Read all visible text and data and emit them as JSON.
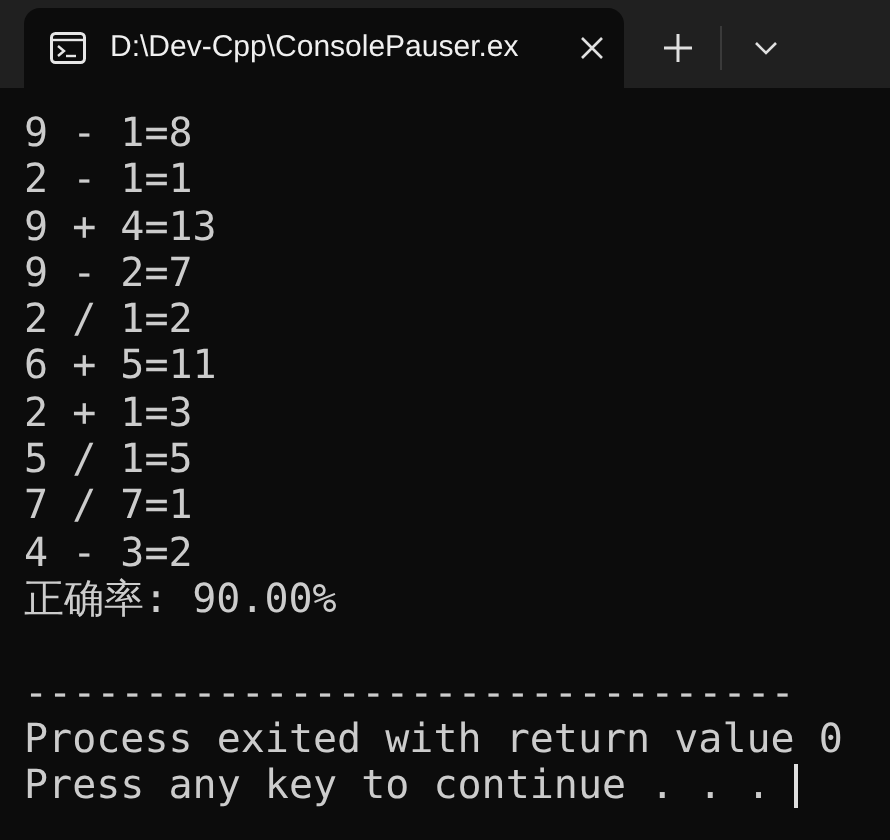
{
  "tab": {
    "title": "D:\\Dev-Cpp\\ConsolePauser.ex",
    "selected": true
  },
  "console": {
    "output": [
      "9 - 1=8",
      "2 - 1=1",
      "9 + 4=13",
      "9 - 2=7",
      "2 / 1=2",
      "6 + 5=11",
      "2 + 1=3",
      "5 / 1=5",
      "7 / 7=1",
      "4 - 3=2",
      "正确率: 90.00%"
    ],
    "separator": "--------------------------------",
    "messages": [
      "Process exited with return value 0",
      "Press any key to continue . . . "
    ]
  }
}
